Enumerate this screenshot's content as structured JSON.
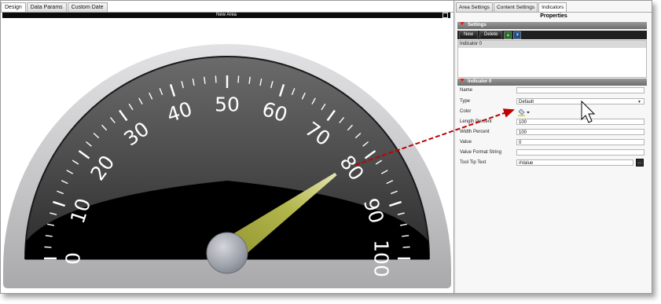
{
  "left_tabs": [
    "Design",
    "Data Params",
    "Custom Date"
  ],
  "area_title": "New Area",
  "gauge": {
    "tick_labels": [
      "0",
      "10",
      "20",
      "30",
      "40",
      "50",
      "60",
      "70",
      "80",
      "90",
      "100"
    ],
    "value": 80,
    "colors": {
      "needle": "#a9ad43",
      "face": "#000000",
      "rim": "#c9c9cb"
    }
  },
  "right_tabs": [
    "Area Settings",
    "Content Settings",
    "Indicators"
  ],
  "properties_title": "Properties",
  "settings_section": "Settings",
  "toolbar": {
    "new_label": "New",
    "delete_label": "Delete",
    "up_icon": "arrow-up-icon",
    "down_icon": "arrow-down-icon"
  },
  "indicator_list": [
    "Indicator 0"
  ],
  "indicator_section": "Indicator 0",
  "fields": {
    "name": {
      "label": "Name",
      "value": ""
    },
    "type": {
      "label": "Type",
      "value": "Default"
    },
    "color": {
      "label": "Color",
      "icon": "paint-bucket-icon"
    },
    "length": {
      "label": "Length Percent",
      "value": "100"
    },
    "width": {
      "label": "Width Percent",
      "value": "100"
    },
    "value": {
      "label": "Value",
      "value": "0"
    },
    "format": {
      "label": "Value Format String",
      "value": ""
    },
    "tooltip": {
      "label": "Tool Tip Text",
      "value": "#Value",
      "button": "..."
    }
  },
  "annotation_color": "#c00000"
}
